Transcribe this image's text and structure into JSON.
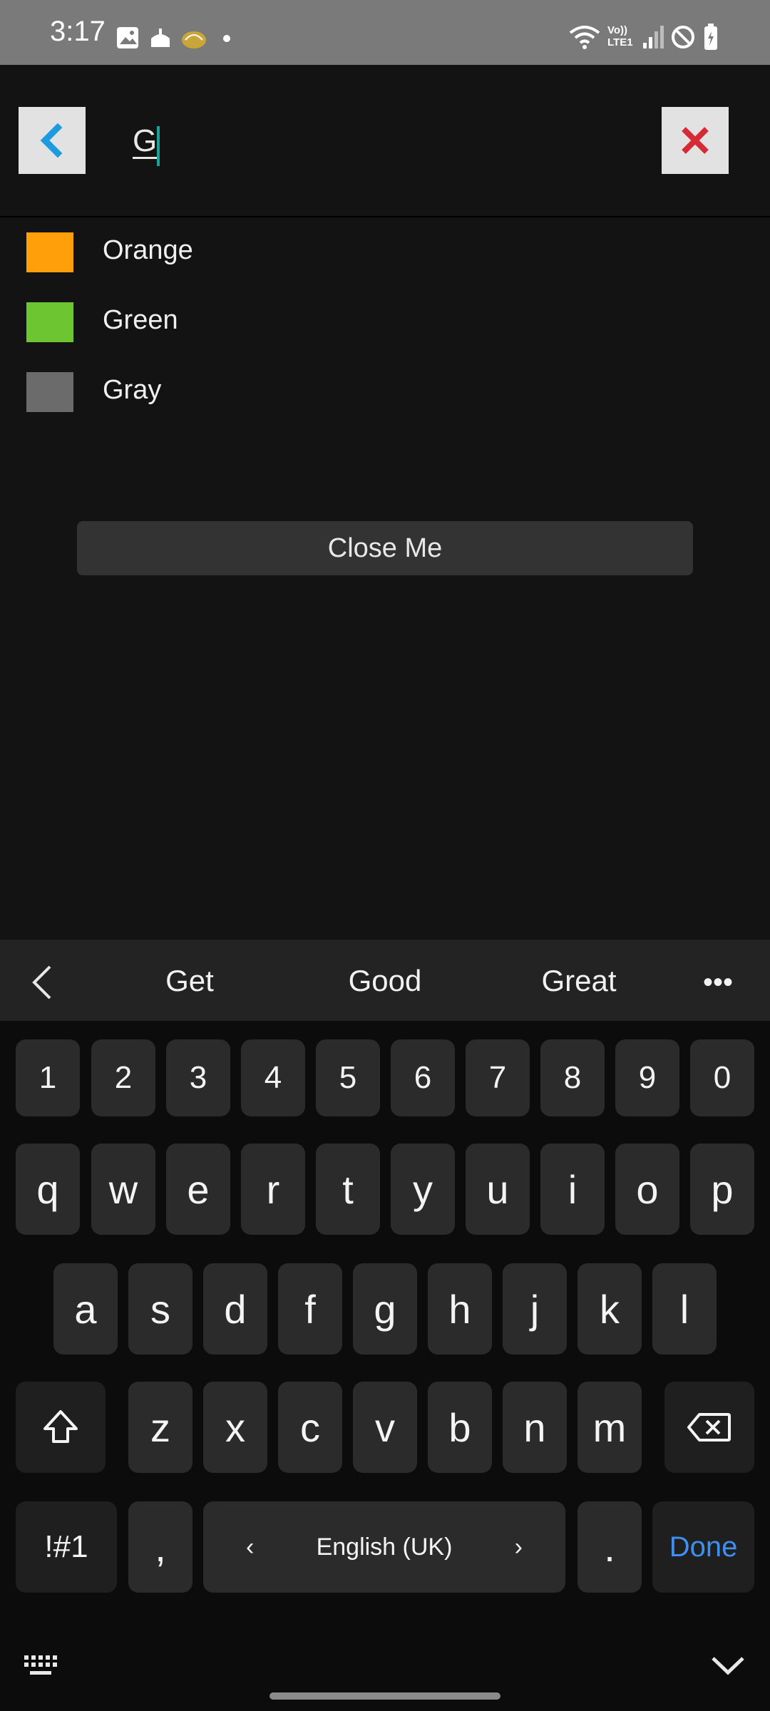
{
  "status_bar": {
    "time": "3:17",
    "network_label": "Vo)) LTE1"
  },
  "search": {
    "value": "G",
    "back_icon": "chevron-left-icon",
    "clear_icon": "close-x-icon"
  },
  "results": [
    {
      "label": "Orange",
      "color": "#ff9f0a"
    },
    {
      "label": "Green",
      "color": "#6cc531"
    },
    {
      "label": "Gray",
      "color": "#6b6b6b"
    }
  ],
  "close_button": {
    "label": "Close Me"
  },
  "keyboard": {
    "suggestions": [
      "Get",
      "Good",
      "Great"
    ],
    "more": "•••",
    "number_row": [
      "1",
      "2",
      "3",
      "4",
      "5",
      "6",
      "7",
      "8",
      "9",
      "0"
    ],
    "row1": [
      "q",
      "w",
      "e",
      "r",
      "t",
      "y",
      "u",
      "i",
      "o",
      "p"
    ],
    "row2": [
      "a",
      "s",
      "d",
      "f",
      "g",
      "h",
      "j",
      "k",
      "l"
    ],
    "row3": [
      "z",
      "x",
      "c",
      "v",
      "b",
      "n",
      "m"
    ],
    "symbols_label": "!#1",
    "comma": ",",
    "period": ".",
    "space_label": "English (UK)",
    "space_left": "‹",
    "space_right": "›",
    "done_label": "Done"
  },
  "colors": {
    "app_background": "#131313",
    "accent_caret": "#1aa39a",
    "back_chevron": "#1e9be0",
    "clear_x": "#d62b36",
    "done_blue": "#3f8ff0"
  }
}
